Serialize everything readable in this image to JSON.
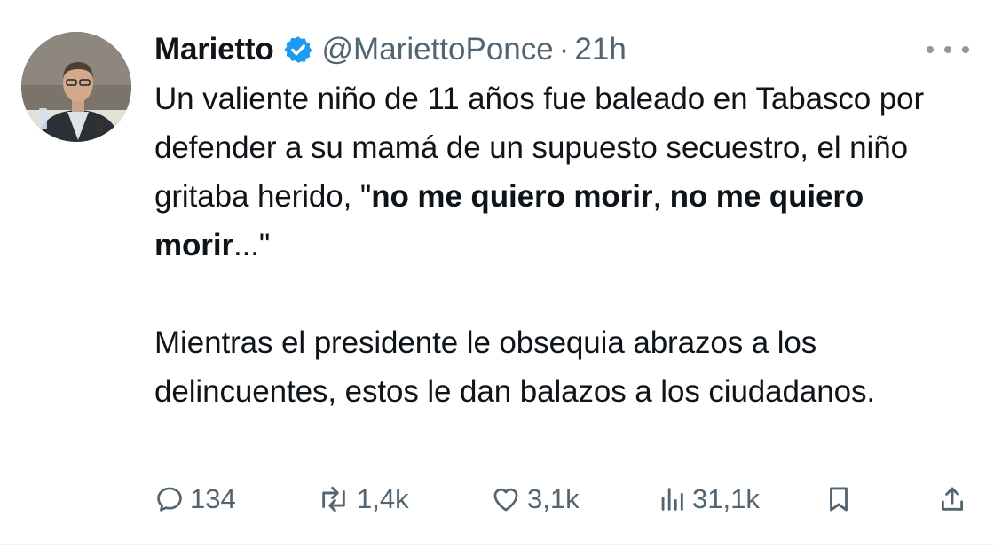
{
  "user": {
    "display_name": "Marietto",
    "handle": "@MariettoPonce",
    "separator": "·",
    "timestamp": "21h",
    "verified": true,
    "verified_color": "#1d9bf0"
  },
  "body": {
    "p1_a": "Un valiente niño de 11 años fue baleado en Tabasco por defender a su mamá de un supuesto secuestro, el niño gritaba herido, \"",
    "p1_bold1": "no me quiero morir",
    "p1_b": ", ",
    "p1_bold2": "no me quiero morir",
    "p1_c": "...\"",
    "p2": "Mientras el presidente le obsequia abrazos a los delincuentes, estos le dan balazos a los ciudadanos."
  },
  "actions": {
    "replies": "134",
    "reposts": "1,4k",
    "likes": "3,1k",
    "views": "31,1k"
  },
  "icons": {
    "reply": "reply-icon",
    "repost": "repost-icon",
    "like": "heart-icon",
    "views": "views-icon",
    "bookmark": "bookmark-icon",
    "share": "share-icon",
    "more": "more-icon"
  },
  "colors": {
    "text": "#0f1419",
    "secondary": "#536471",
    "accent": "#1d9bf0"
  }
}
